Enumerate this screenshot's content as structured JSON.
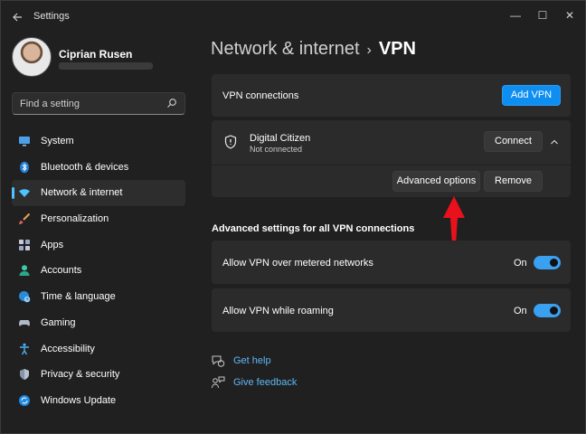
{
  "window": {
    "title": "Settings",
    "controls": {
      "minimize": "—",
      "maximize": "☐",
      "close": "✕"
    }
  },
  "profile": {
    "name": "Ciprian Rusen"
  },
  "search": {
    "placeholder": "Find a setting"
  },
  "sidebar": {
    "items": [
      {
        "label": "System",
        "icon": "monitor-icon"
      },
      {
        "label": "Bluetooth & devices",
        "icon": "bluetooth-icon"
      },
      {
        "label": "Network & internet",
        "icon": "wifi-icon",
        "active": true
      },
      {
        "label": "Personalization",
        "icon": "brush-icon"
      },
      {
        "label": "Apps",
        "icon": "apps-icon"
      },
      {
        "label": "Accounts",
        "icon": "person-icon"
      },
      {
        "label": "Time & language",
        "icon": "globe-clock-icon"
      },
      {
        "label": "Gaming",
        "icon": "gamepad-icon"
      },
      {
        "label": "Accessibility",
        "icon": "accessibility-icon"
      },
      {
        "label": "Privacy & security",
        "icon": "shield-icon"
      },
      {
        "label": "Windows Update",
        "icon": "update-icon"
      }
    ]
  },
  "breadcrumb": {
    "parent": "Network & internet",
    "separator": "›",
    "current": "VPN"
  },
  "vpn_connections": {
    "label": "VPN connections",
    "add_button": "Add VPN"
  },
  "vpn_entry": {
    "name": "Digital Citizen",
    "status": "Not connected",
    "connect_button": "Connect",
    "advanced_button": "Advanced options",
    "remove_button": "Remove"
  },
  "advanced_settings": {
    "title": "Advanced settings for all VPN connections",
    "options": [
      {
        "label": "Allow VPN over metered networks",
        "state": "On",
        "enabled": true
      },
      {
        "label": "Allow VPN while roaming",
        "state": "On",
        "enabled": true
      }
    ]
  },
  "links": {
    "help": "Get help",
    "feedback": "Give feedback"
  },
  "colors": {
    "accent": "#0f8ef2",
    "annotation_arrow": "#e8111c",
    "background": "#202020",
    "card": "#2b2b2b"
  }
}
